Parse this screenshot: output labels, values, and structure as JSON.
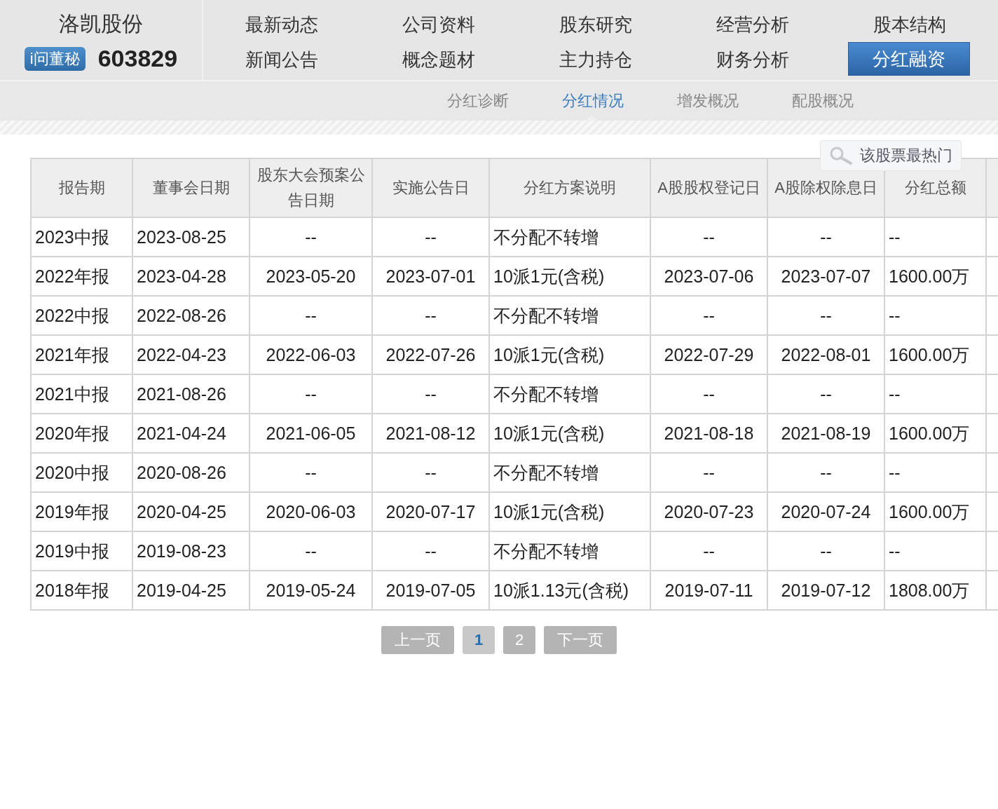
{
  "company": {
    "name": "洛凯股份",
    "badge": "i问董秘",
    "code": "603829"
  },
  "nav": [
    {
      "label": "最新动态",
      "selected": false
    },
    {
      "label": "公司资料",
      "selected": false
    },
    {
      "label": "股东研究",
      "selected": false
    },
    {
      "label": "经营分析",
      "selected": false
    },
    {
      "label": "股本结构",
      "selected": false
    },
    {
      "label": "新闻公告",
      "selected": false
    },
    {
      "label": "概念题材",
      "selected": false
    },
    {
      "label": "主力持仓",
      "selected": false
    },
    {
      "label": "财务分析",
      "selected": false
    },
    {
      "label": "分红融资",
      "selected": true
    }
  ],
  "subnav": [
    {
      "label": "分红诊断",
      "selected": false
    },
    {
      "label": "分红情况",
      "selected": true
    },
    {
      "label": "增发概况",
      "selected": false
    },
    {
      "label": "配股概况",
      "selected": false
    }
  ],
  "search_tip": {
    "text": "该股票最热门"
  },
  "table": {
    "columns": [
      "报告期",
      "董事会日期",
      "股东大会预案公告日期",
      "实施公告日",
      "分红方案说明",
      "A股股权登记日",
      "A股除权除息日",
      "分红总额"
    ],
    "rows": [
      {
        "cells": [
          "2023中报",
          "2023-08-25",
          "--",
          "--",
          "不分配不转增",
          "--",
          "--",
          "--"
        ]
      },
      {
        "cells": [
          "2022年报",
          "2023-04-28",
          "2023-05-20",
          "2023-07-01",
          "10派1元(含税)",
          "2023-07-06",
          "2023-07-07",
          "1600.00万"
        ]
      },
      {
        "cells": [
          "2022中报",
          "2022-08-26",
          "--",
          "--",
          "不分配不转增",
          "--",
          "--",
          "--"
        ]
      },
      {
        "cells": [
          "2021年报",
          "2022-04-23",
          "2022-06-03",
          "2022-07-26",
          "10派1元(含税)",
          "2022-07-29",
          "2022-08-01",
          "1600.00万"
        ]
      },
      {
        "cells": [
          "2021中报",
          "2021-08-26",
          "--",
          "--",
          "不分配不转增",
          "--",
          "--",
          "--"
        ]
      },
      {
        "cells": [
          "2020年报",
          "2021-04-24",
          "2021-06-05",
          "2021-08-12",
          "10派1元(含税)",
          "2021-08-18",
          "2021-08-19",
          "1600.00万"
        ]
      },
      {
        "cells": [
          "2020中报",
          "2020-08-26",
          "--",
          "--",
          "不分配不转增",
          "--",
          "--",
          "--"
        ]
      },
      {
        "cells": [
          "2019年报",
          "2020-04-25",
          "2020-06-03",
          "2020-07-17",
          "10派1元(含税)",
          "2020-07-23",
          "2020-07-24",
          "1600.00万"
        ]
      },
      {
        "cells": [
          "2019中报",
          "2019-08-23",
          "--",
          "--",
          "不分配不转增",
          "--",
          "--",
          "--"
        ]
      },
      {
        "cells": [
          "2018年报",
          "2019-04-25",
          "2019-05-24",
          "2019-07-05",
          "10派1.13元(含税)",
          "2019-07-11",
          "2019-07-12",
          "1808.00万"
        ]
      }
    ]
  },
  "pagination": {
    "prev": "上一页",
    "pages": [
      {
        "label": "1",
        "selected": true
      },
      {
        "label": "2",
        "selected": false
      }
    ],
    "next": "下一页"
  }
}
